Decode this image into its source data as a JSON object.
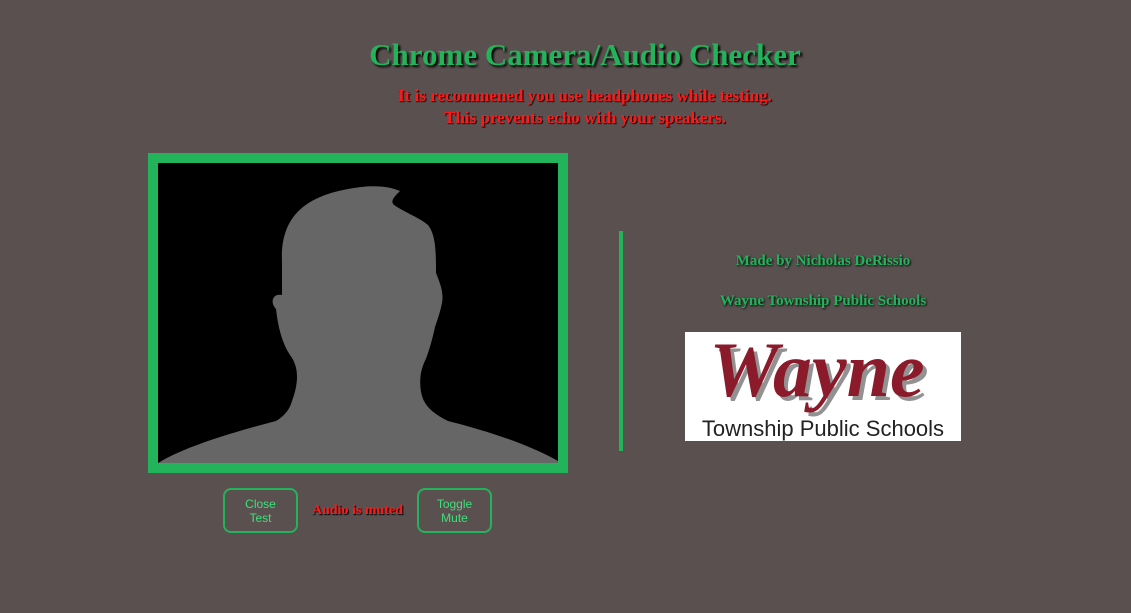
{
  "header": {
    "title": "Chrome Camera/Audio Checker",
    "warning_line1": "It is recommened you use headphones while testing.",
    "warning_line2": "This prevents echo with your speakers."
  },
  "video": {
    "placeholder_icon": "person-silhouette-icon"
  },
  "controls": {
    "close_label": "Close\nTest",
    "mute_status": "Audio is muted",
    "toggle_label": "Toggle\nMute"
  },
  "credits": {
    "author": "Made by Nicholas DeRissio",
    "organization": "Wayne Township Public Schools"
  },
  "logo": {
    "wordmark": "Wayne",
    "subtitle": "Township Public Schools"
  },
  "colors": {
    "background": "#5a5050",
    "accent_green": "#23b35a",
    "warning_red": "#ff1a1a",
    "logo_maroon": "#8b1a2b"
  }
}
